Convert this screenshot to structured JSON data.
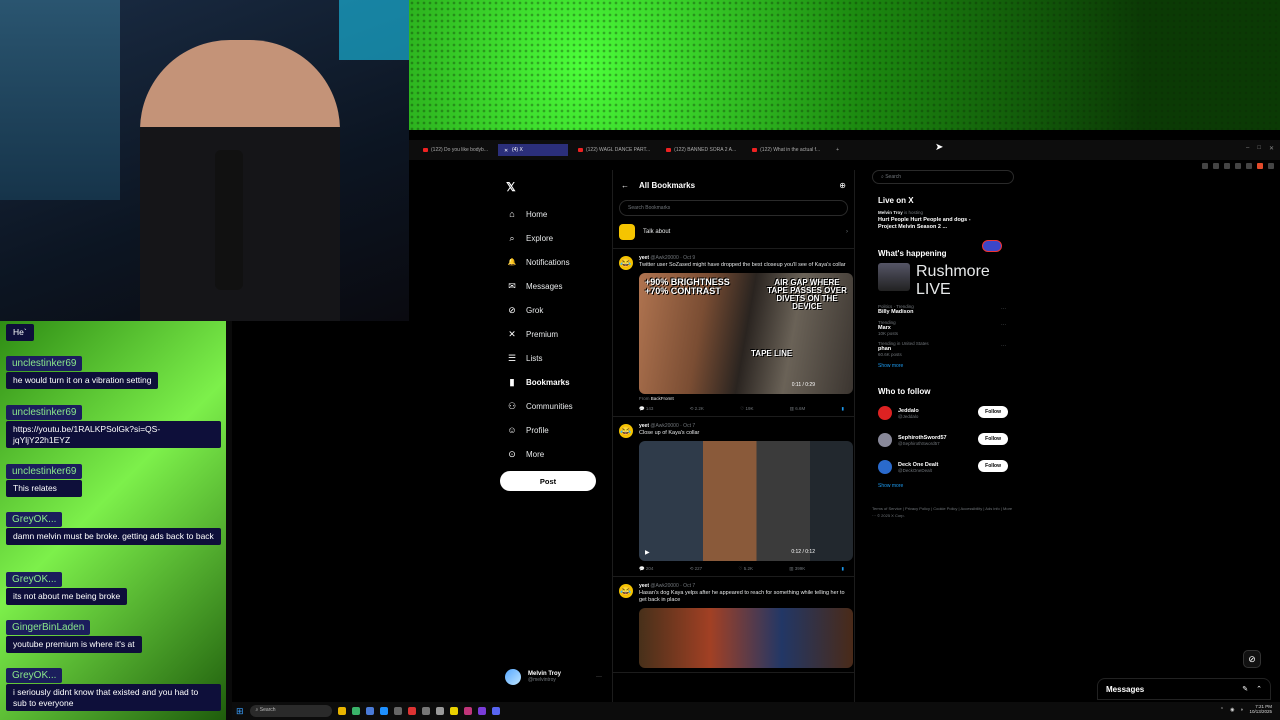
{
  "chat": {
    "messages": [
      {
        "user": "",
        "text": "He`"
      },
      {
        "user": "unclestinker69",
        "text": "he would turn it on a vibration setting"
      },
      {
        "user": "unclestinker69",
        "text": "https://youtu.be/1RALKPSolGk?si=QS-jqYljY22h1EYZ"
      },
      {
        "user": "unclestinker69",
        "text": "This relates"
      },
      {
        "user": "GreyOK...",
        "text": "damn melvin must be broke. getting ads back to back"
      },
      {
        "user": "GreyOK...",
        "text": "its not about me being broke"
      },
      {
        "user": "GingerBinLaden",
        "text": "youtube premium is where it's at"
      },
      {
        "user": "GreyOK...",
        "text": "i seriously didnt know that existed and you had to sub to everyone"
      }
    ]
  },
  "browser": {
    "tabs": [
      {
        "label": "(122) Do you like bodyb..."
      },
      {
        "label": "(4) X"
      },
      {
        "label": "(122) WAGL DANCE PART..."
      },
      {
        "label": "(122) BANNED SORA 2 A..."
      },
      {
        "label": "(122) What in the actual f..."
      }
    ]
  },
  "nav": {
    "items": [
      {
        "label": "Home",
        "icon": "home-icon",
        "glyph": "⌂"
      },
      {
        "label": "Explore",
        "icon": "search-icon",
        "glyph": "⌕"
      },
      {
        "label": "Notifications",
        "icon": "bell-icon",
        "glyph": "🔔"
      },
      {
        "label": "Messages",
        "icon": "mail-icon",
        "glyph": "✉"
      },
      {
        "label": "Grok",
        "icon": "grok-icon",
        "glyph": "⊘"
      },
      {
        "label": "Premium",
        "icon": "x-icon",
        "glyph": "✕"
      },
      {
        "label": "Lists",
        "icon": "list-icon",
        "glyph": "☰"
      },
      {
        "label": "Bookmarks",
        "icon": "bookmark-icon",
        "glyph": "▮"
      },
      {
        "label": "Communities",
        "icon": "people-icon",
        "glyph": "⚇"
      },
      {
        "label": "Profile",
        "icon": "person-icon",
        "glyph": "☺"
      },
      {
        "label": "More",
        "icon": "more-icon",
        "glyph": "⊙"
      }
    ],
    "post_label": "Post",
    "account": {
      "name": "Melvin Troy",
      "handle": "@melvintroy"
    }
  },
  "main": {
    "title": "All Bookmarks",
    "search_placeholder": "Search Bookmarks",
    "talk_label": "Talk about",
    "tweets": [
      {
        "name": "yeet",
        "meta": "@Awk20000 · Oct 9",
        "text": "Twitter user SoZased might have dropped the best closeup you'll see of Kaya's collar",
        "overlay_left": "+90% BRIGHTNESS +70% CONTRAST",
        "overlay_right": "AIR GAP WHERE TAPE PASSES OVER DIVETS ON THE DEVICE",
        "overlay_bottom": "TAPE LINE",
        "time": "0:11 / 0:29",
        "from": "From",
        "from_name": "BackFromIt",
        "stats": {
          "reply": "143",
          "repost": "2.2K",
          "like": "19K",
          "views": "6.6M"
        }
      },
      {
        "name": "yeet",
        "meta": "@Awk20000 · Oct 7",
        "text": "Close up of Kaya's collar",
        "time": "0:12 / 0:12",
        "stats": {
          "reply": "204",
          "repost": "227",
          "like": "5.2K",
          "views": "399K"
        }
      },
      {
        "name": "yeet",
        "meta": "@Awk20000 · Oct 7",
        "text": "Hasan's dog Kaya yelps after he appeared to reach for something while telling her to get back in place"
      }
    ]
  },
  "side": {
    "search_placeholder": "Search",
    "live": {
      "title": "Live on X",
      "host": "Melvin Troy",
      "host_status": "is hosting",
      "space_title": "Hurt People Hurt People and dogs - Project Melvin Season 2 ..."
    },
    "happening": {
      "title": "What's happening",
      "featured": {
        "name": "Rushmore",
        "sub": "LIVE"
      },
      "trends": [
        {
          "context": "Politics · Trending",
          "name": "Billy Madison",
          "count": ""
        },
        {
          "context": "Trending",
          "name": "Marx",
          "count": "10K posts"
        },
        {
          "context": "Trending in United States",
          "name": "phan",
          "count": "60.6K posts"
        }
      ],
      "show_more": "Show more"
    },
    "follow": {
      "title": "Who to follow",
      "people": [
        {
          "name": "Jeddalo",
          "handle": "@Jeddalo",
          "color": "#d22"
        },
        {
          "name": "SephirothSword57",
          "handle": "@SephirothSword57",
          "color": "#889"
        },
        {
          "name": "Deck One Dealt",
          "handle": "@DeckOneDealt",
          "color": "#2a6acc"
        }
      ],
      "button": "Follow",
      "show_more": "Show more"
    },
    "footer": "Terms of Service | Privacy Policy | Cookie Policy | Accessibility | Ads info | More ··· © 2025 X Corp."
  },
  "messages_dock": {
    "label": "Messages"
  },
  "taskbar": {
    "search": "Search",
    "time": "7:21 PM",
    "date": "10/13/2025"
  }
}
